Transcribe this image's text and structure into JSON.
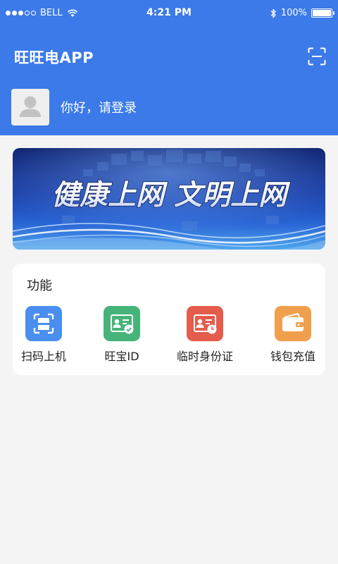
{
  "status_bar": {
    "carrier": "BELL",
    "time": "4:21 PM",
    "battery": "100%",
    "battery_level": 1.0
  },
  "header": {
    "title": "旺旺电APP",
    "scan_icon": "scan-icon",
    "login_prompt": "你好，请登录",
    "background_color": "#3b7ae8"
  },
  "banner": {
    "text": "健康上网 文明上网"
  },
  "functions": {
    "title": "功能",
    "items": [
      {
        "label": "扫码上机",
        "icon": "scan-icon",
        "color": "#4a8ef0"
      },
      {
        "label": "旺宝ID",
        "icon": "id-card-check-icon",
        "color": "#46b37a"
      },
      {
        "label": "临时身份证",
        "icon": "id-card-clock-icon",
        "color": "#e45c4c"
      },
      {
        "label": "钱包充值",
        "icon": "wallet-icon",
        "color": "#f0a04c"
      }
    ]
  }
}
